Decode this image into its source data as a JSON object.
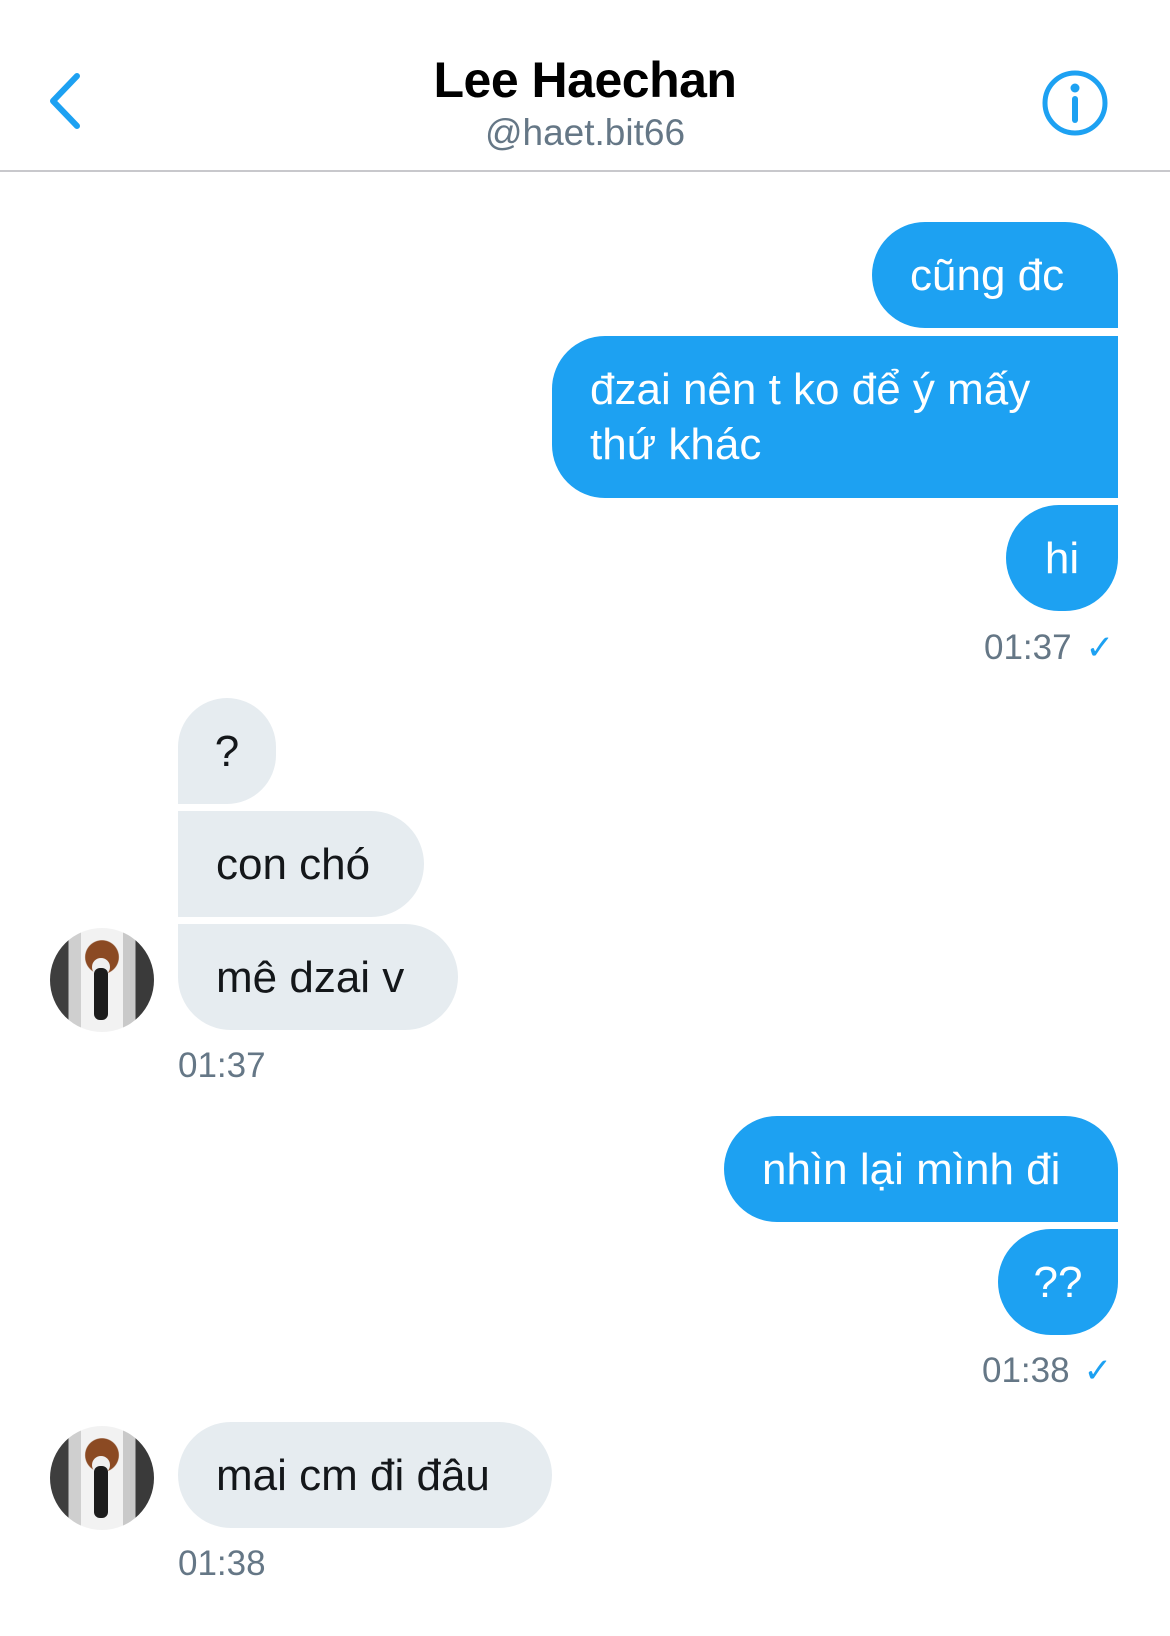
{
  "header": {
    "title": "Lee Haechan",
    "handle": "@haet.bit66",
    "back_icon": "chevron-left-icon",
    "info_icon": "info-icon"
  },
  "colors": {
    "accent": "#1da1f2",
    "incoming_bubble": "#e6ecf0",
    "meta_text": "#657786"
  },
  "messages": {
    "m1": "cũng đc",
    "m2": "đzai nên t ko để ý mấy thứ khác",
    "m3": "hi",
    "t1": "01:37",
    "r1": "?",
    "r2": "con chó",
    "r3": "mê dzai v",
    "t2": "01:37",
    "m4": "nhìn lại mình đi",
    "m5": "??",
    "t3": "01:38",
    "r4": "mai cm đi đâu",
    "t4": "01:38"
  },
  "read_receipt_glyph": "✓"
}
